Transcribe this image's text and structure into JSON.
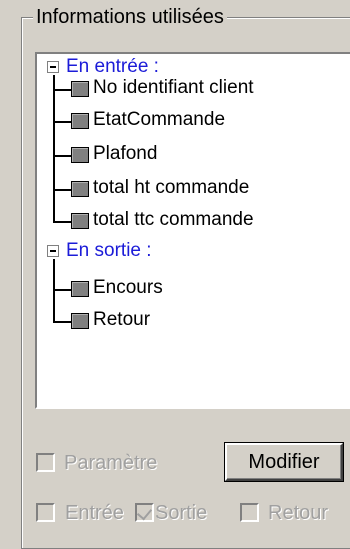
{
  "group": {
    "title": "Informations utilisées"
  },
  "tree": {
    "inputs": {
      "label": "En entrée :",
      "items": [
        "No identifiant client",
        "EtatCommande",
        "Plafond",
        "total ht commande",
        "total ttc commande"
      ]
    },
    "outputs": {
      "label": "En sortie :",
      "items": [
        "Encours",
        "Retour"
      ]
    }
  },
  "controls": {
    "parametre_label": "Paramètre",
    "modifier_label": "Modifier",
    "entree_label": "Entrée",
    "sortie_label": "Sortie",
    "retour_label": "Retour",
    "parametre_checked": false,
    "entree_checked": false,
    "sortie_checked": true,
    "retour_checked": false
  }
}
